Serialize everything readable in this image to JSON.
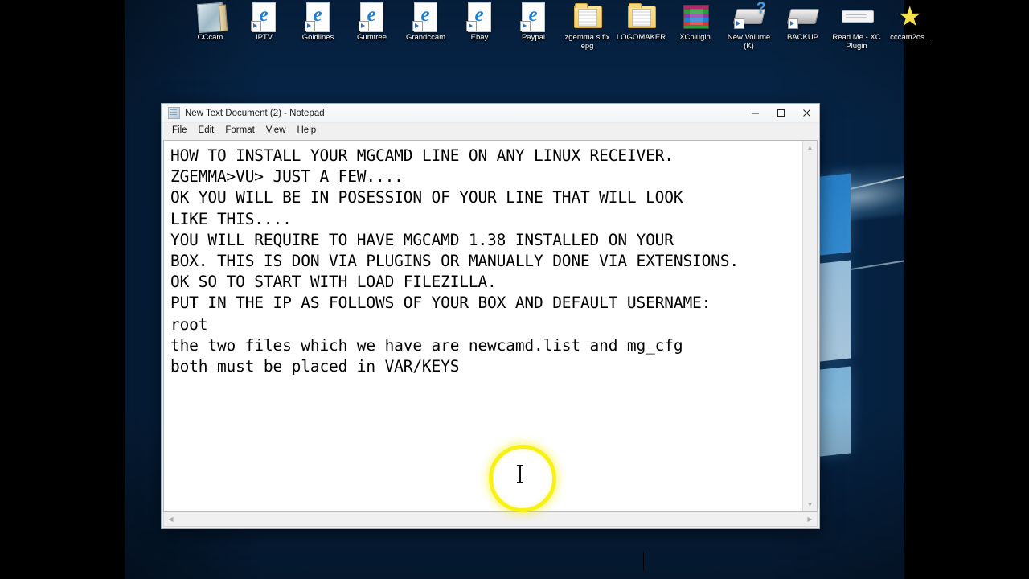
{
  "desktop": {
    "icons": [
      {
        "label": "CCcam",
        "icon": "notepad-document-icon",
        "type": "cccam"
      },
      {
        "label": "IPTV",
        "icon": "internet-explorer-shortcut-icon",
        "type": "ie"
      },
      {
        "label": "Goldlines",
        "icon": "internet-explorer-shortcut-icon",
        "type": "ie"
      },
      {
        "label": "Gumtree",
        "icon": "internet-explorer-shortcut-icon",
        "type": "ie"
      },
      {
        "label": "Grandccam",
        "icon": "internet-explorer-shortcut-icon",
        "type": "ie"
      },
      {
        "label": "Ebay",
        "icon": "internet-explorer-shortcut-icon",
        "type": "ie"
      },
      {
        "label": "Paypal",
        "icon": "internet-explorer-shortcut-icon",
        "type": "ie"
      },
      {
        "label": "zgemma s fix epg",
        "icon": "folder-icon",
        "type": "folder"
      },
      {
        "label": "LOGOMAKER",
        "icon": "folder-icon",
        "type": "folder"
      },
      {
        "label": "XCplugin",
        "icon": "winrar-archive-icon",
        "type": "rar"
      },
      {
        "label": "New Volume (K)",
        "icon": "disk-drive-icon",
        "type": "drive"
      },
      {
        "label": "BACKUP",
        "icon": "disk-drive-icon",
        "type": "drive-plain"
      },
      {
        "label": "Read Me - XC Plugin",
        "icon": "text-document-icon",
        "type": "readme"
      },
      {
        "label": "cccam2os...",
        "icon": "star-icon",
        "type": "star"
      }
    ]
  },
  "window": {
    "title": "New Text Document (2) - Notepad",
    "title_icon": "notepad-icon",
    "controls": {
      "minimize": "minimize-button",
      "maximize": "maximize-button",
      "close": "close-button"
    },
    "menu": [
      "File",
      "Edit",
      "Format",
      "View",
      "Help"
    ],
    "document_lines": [
      "HOW TO INSTALL YOUR MGCAMD LINE ON ANY LINUX RECEIVER.",
      "ZGEMMA>VU> JUST A FEW....",
      "",
      "OK YOU WILL BE IN POSESSION OF YOUR LINE THAT WILL LOOK",
      "LIKE THIS....",
      "",
      "YOU WILL REQUIRE TO HAVE MGCAMD 1.38 INSTALLED ON YOUR",
      "BOX. THIS IS DON VIA PLUGINS OR MANUALLY DONE VIA EXTENSIONS.",
      "",
      "OK SO TO START WITH LOAD FILEZILLA.",
      "",
      "PUT IN THE IP AS FOLLOWS OF YOUR BOX AND DEFAULT USERNAME:",
      "root",
      "",
      "the two files which we have are newcamd.list and mg_cfg",
      "both must be placed in VAR/KEYS"
    ],
    "scrollbar": {
      "up_arrow": "▲",
      "down_arrow": "▼",
      "left_arrow": "◀",
      "right_arrow": "▶"
    }
  },
  "cursor": {
    "type": "text-ibeam",
    "highlight_color": "#f7f117"
  },
  "colors": {
    "accent": "#f7f117",
    "wallpaper": "#07274c",
    "window_chrome": "#f0f0f0"
  }
}
